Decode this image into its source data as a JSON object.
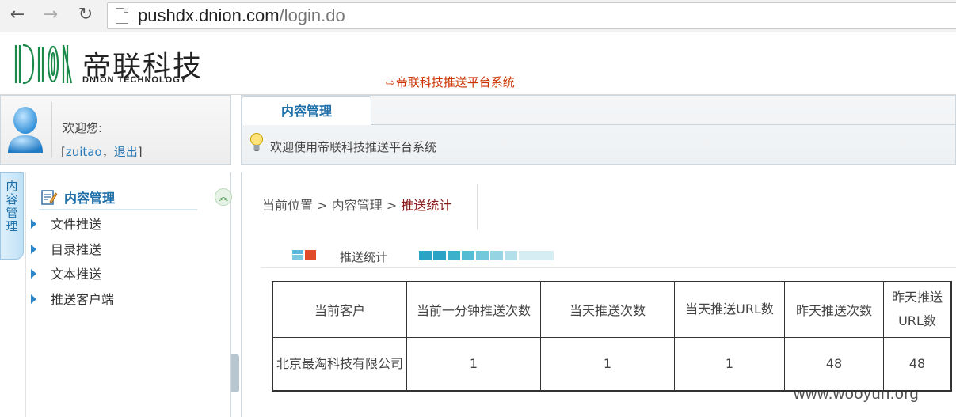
{
  "browser": {
    "url_host": "pushdx.dnion.com",
    "url_path": "/login.do",
    "back_icon": "←",
    "forward_icon": "→",
    "reload_icon": "↻"
  },
  "header": {
    "logo_cn": "帝联科技",
    "logo_en": "DNION TECHNOLOGY",
    "system_title": "帝联科技推送平台系统",
    "system_title_arrow": "⇨"
  },
  "user": {
    "welcome": "欢迎您:",
    "bracket_open": "[",
    "username": "zuitao",
    "separator": "，",
    "logout": "退出",
    "bracket_close": "]"
  },
  "tabs": {
    "active_label": "内容管理",
    "message": "欢迎使用帝联科技推送平台系统"
  },
  "sidebar": {
    "vertical_tab": [
      "内",
      "容",
      "管",
      "理"
    ],
    "section_title": "内容管理",
    "items": [
      {
        "label": "文件推送"
      },
      {
        "label": "目录推送"
      },
      {
        "label": "文本推送"
      },
      {
        "label": "推送客户端"
      }
    ]
  },
  "breadcrumb": {
    "prefix": "当前位置",
    "sep1": ">",
    "level1": "内容管理",
    "sep2": ">",
    "current": "推送统计"
  },
  "section": {
    "title": "推送统计"
  },
  "table": {
    "headers": [
      "当前客户",
      "当前一分钟推送次数",
      "当天推送次数",
      "当天推送URL数",
      "昨天推送次数",
      "昨天推送URL数"
    ],
    "rows": [
      [
        "北京最淘科技有限公司",
        "1",
        "1",
        "1",
        "48",
        "48"
      ]
    ]
  },
  "watermark": "www.wooyun.org",
  "colors": {
    "accent_blue": "#1f6fa8",
    "link_blue": "#2a7ab8",
    "title_red": "#cc3300",
    "crumb_current": "#8b1a1a"
  }
}
